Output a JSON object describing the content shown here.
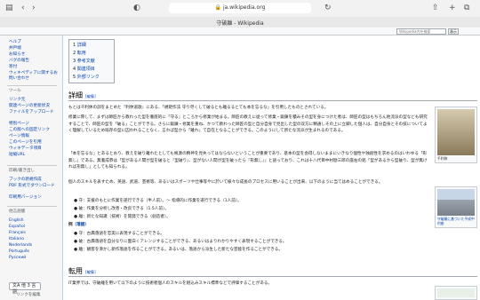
{
  "browser": {
    "url": "ja.wikipedia.org",
    "tab_title": "守破離 - Wikipedia",
    "icons": [
      "sidebar-icon",
      "back-icon",
      "forward-icon",
      "shield-icon",
      "lock-icon",
      "reload-icon",
      "share-icon",
      "new-tab-icon",
      "tabs-icon"
    ]
  },
  "wikibar": {
    "search_placeholder": "Wikipedia内を検索",
    "go_label": "表示"
  },
  "sidebar": {
    "nav": [
      "ヘルプ",
      "井戸端",
      "お知らせ",
      "バグの報告",
      "寄付",
      "ウィキペディアに関するお問い合わせ"
    ],
    "tools_head": "ツール",
    "tools": [
      "リンク元",
      "関連ページの更新状況",
      "ファイルをアップロード",
      "特別ページ",
      "この版への固定リンク",
      "ページ情報",
      "このページを引用",
      "ウィキデータ項目",
      "短縮URL"
    ],
    "print_head": "印刷/書き出し",
    "print": [
      "ブックの新規作成",
      "PDF 形式でダウンロード",
      "印刷用バージョン"
    ],
    "lang_head": "他言語版",
    "langs": [
      "English",
      "Español",
      "Français",
      "Italiano",
      "Nederlands",
      "Português",
      "Русский"
    ],
    "lang_btn": "文A 他 3 言語",
    "edit_links": "リンクを編集"
  },
  "toc": [
    {
      "num": "1",
      "label": "詳細"
    },
    {
      "num": "2",
      "label": "転用"
    },
    {
      "num": "3",
      "label": "参考文献"
    },
    {
      "num": "4",
      "label": "関連項目"
    },
    {
      "num": "5",
      "label": "外部リンク"
    }
  ],
  "section1": {
    "title": "詳細",
    "edit": "[編集]",
    "p1": "もとは千利休の訓をまとめた『利休道歌』にある、「規矩作法 守り尽くして破るとも離るるとても本を忘るな」を引用したものとされている。",
    "p2": "修業に際して、まずは師匠から教わった型を徹底的に「守る」ところから修業が始まる。師匠の教えに従って修業・鍛錬を積みその型を身につけた者は、師匠の型はもちろん他流派の型なども研究することで、師匠の型を「破る」ことができる。さらに鍛錬・修業を重ね、かつて教わった師匠の型と自分自身で見出した型の双方に精通しその上に立脚した個人は、自分自身とその技についてよく理解しているため既存の型に囚われることなく、言わば型から「離れ」て自在となることができる。このようにして新たな流派が生まれるのである。",
    "p3": "「本を忘るな」とあるとおり、教えを破り離れたとしても根源の精神を見失ってはならないということが重要であり、基本の型を会得しないままにいきなり個性や独創性を求めるのはいわゆる「形無し」である。無着成恭は「型がある人間が型を破ると『型破り』、型がない人間が型を破ったら『形無し』」と語っており、これは十八代目中村勘三郎の座右の銘「型があるから型破り、型が無ければ形無し」としても知られる。",
    "p4": "個人のスキルを表すため、英語、武道、芸術等、あるいはスポーツや仕事等やに於いて様々な成長のプロセスに用いることが出来、以下のように当てはめることができる。",
    "list1": [
      "守：支援のもとに作業を遂行できる（半人前）。～ 指導的に作業を遂行できる（1人前）。",
      "破：作業を分析し改善・改良できる（1.5人前）。",
      "離：新たな知識（技術）を開発できる（創造者）。"
    ],
    "ex_label": "例",
    "ex_link": "（落語）",
    "list2": [
      "守：古典落語を忠実に表現することができる。",
      "破：古典落語を自分なりに面白くアレンジすることができる、あるいはよりわかりやすく表現することができる。",
      "離：観客を沸かし新作落語を作ることができる。あるいは、落語から派生した新たな芸能を作ることができる。"
    ]
  },
  "section2": {
    "title": "転用",
    "edit": "[編集]",
    "p1": "IT業界では、守破離を用いて以下のように技術者個人のスキルを組込みスキル標準などで評価することがある。"
  },
  "thumbs": [
    {
      "caption": "千利休"
    },
    {
      "caption": "守破離に基づいた平成中村座"
    }
  ]
}
